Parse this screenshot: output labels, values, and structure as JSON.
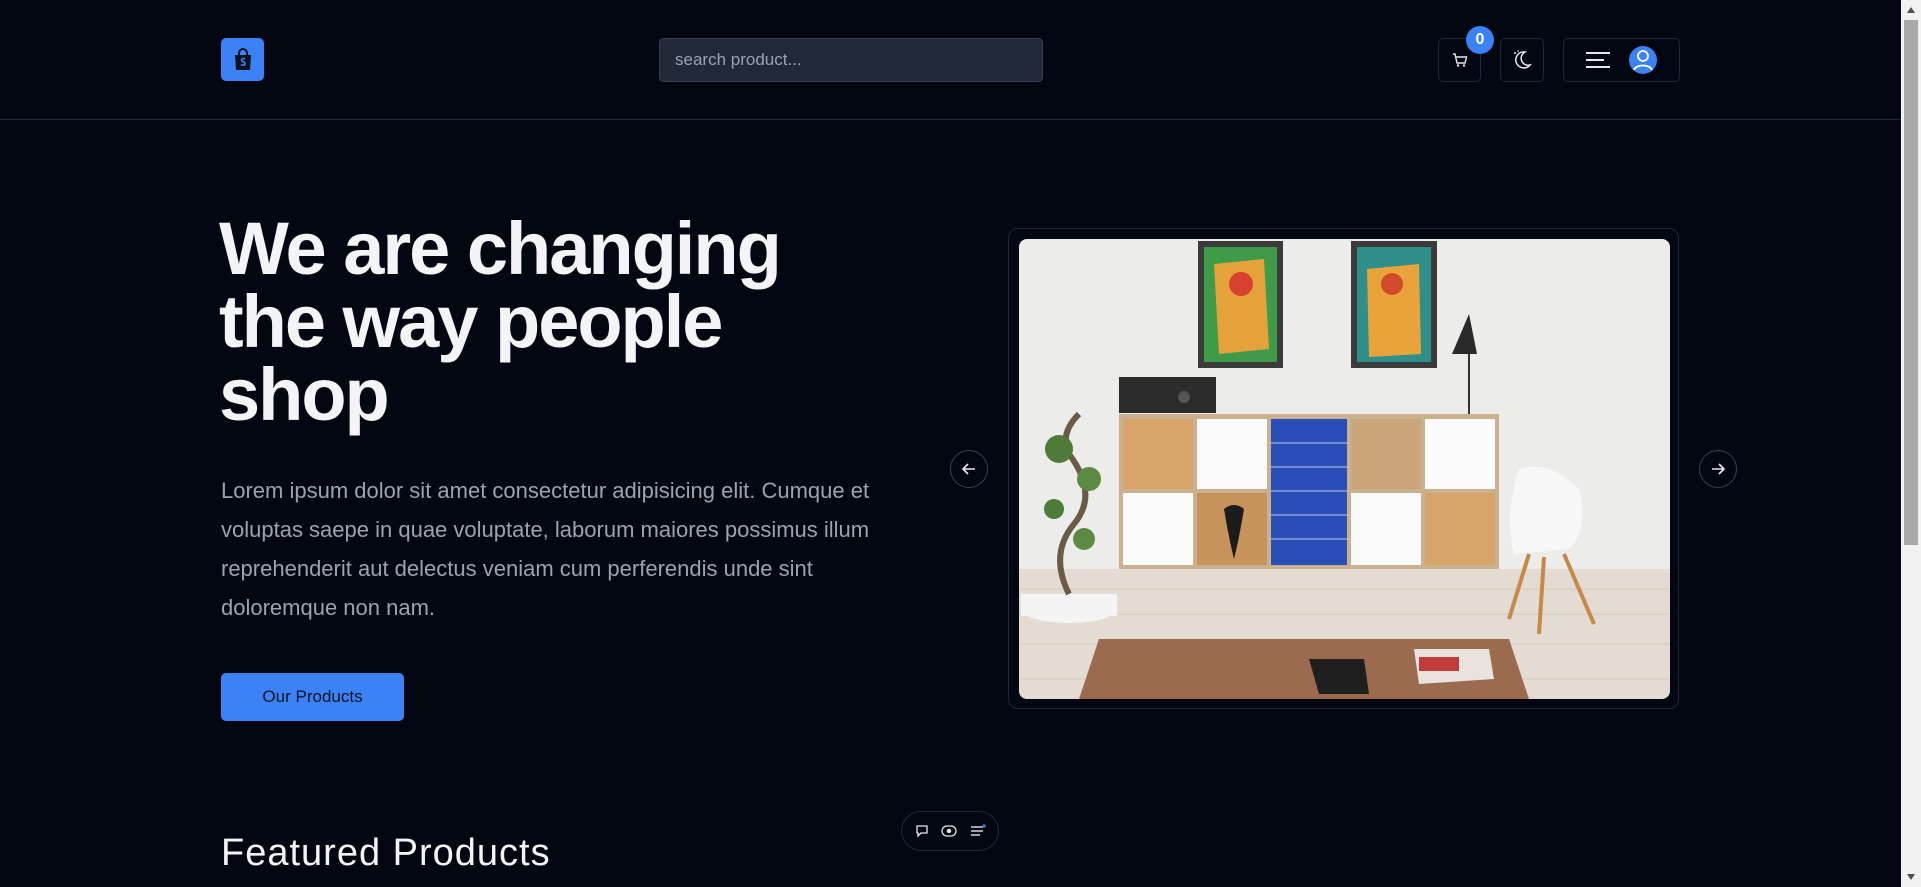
{
  "header": {
    "search": {
      "placeholder": "search product..."
    },
    "cart": {
      "count": "0"
    }
  },
  "hero": {
    "title": "We are changing the way people shop",
    "description": "Lorem ipsum dolor sit amet consectetur adipisicing elit. Cumque et voluptas saepe in quae voluptate, laborum maiores possimus illum reprehenderit aut delectus veniam cum perferendis unde sint doloremque non nam.",
    "cta_label": "Our Products"
  },
  "featured": {
    "title": "Featured Products"
  },
  "icons": {
    "logo": "shopping-bag-icon",
    "cart": "cart-icon",
    "theme": "moon-icon",
    "menu": "menu-icon",
    "user": "user-icon",
    "prev": "arrow-left-icon",
    "next": "arrow-right-icon",
    "dock": [
      "chat-icon",
      "eye-icon",
      "settings-icon"
    ]
  },
  "colors": {
    "background": "#030712",
    "accent": "#3b82f6",
    "text": "#f3f4f6",
    "muted": "#9ca3af"
  }
}
